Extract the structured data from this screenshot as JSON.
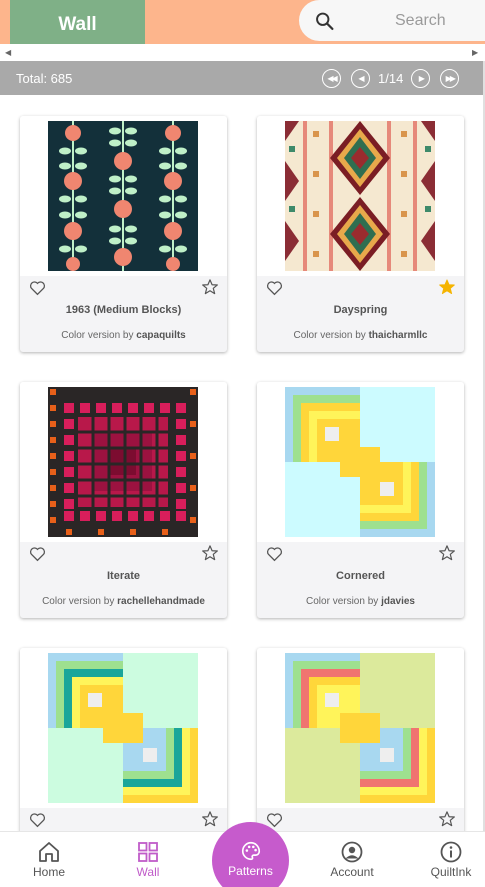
{
  "header": {
    "title": "Wall",
    "search_placeholder": "Search"
  },
  "toolbar": {
    "total_label": "Total: 685",
    "page_info": "1/14"
  },
  "colors": {
    "accent": "#c65bcc",
    "header_bg": "#fdb58c",
    "title_tab": "#7fb087",
    "star_filled": "#f5b400"
  },
  "cards": [
    {
      "name": "1963 (Medium Blocks)",
      "by_prefix": "Color version by",
      "author": "capaquilts",
      "favorited": false
    },
    {
      "name": "Dayspring",
      "by_prefix": "Color version by",
      "author": "thaicharmllc",
      "favorited": true
    },
    {
      "name": "Iterate",
      "by_prefix": "Color version by",
      "author": "rachellehandmade",
      "favorited": false
    },
    {
      "name": "Cornered",
      "by_prefix": "Color version by",
      "author": "jdavies",
      "favorited": false
    },
    {
      "name": "",
      "by_prefix": "",
      "author": "",
      "favorited": false
    },
    {
      "name": "",
      "by_prefix": "",
      "author": "",
      "favorited": false
    }
  ],
  "nav": {
    "home": "Home",
    "wall": "Wall",
    "patterns": "Patterns",
    "account": "Account",
    "quiltink": "QuiltInk"
  }
}
